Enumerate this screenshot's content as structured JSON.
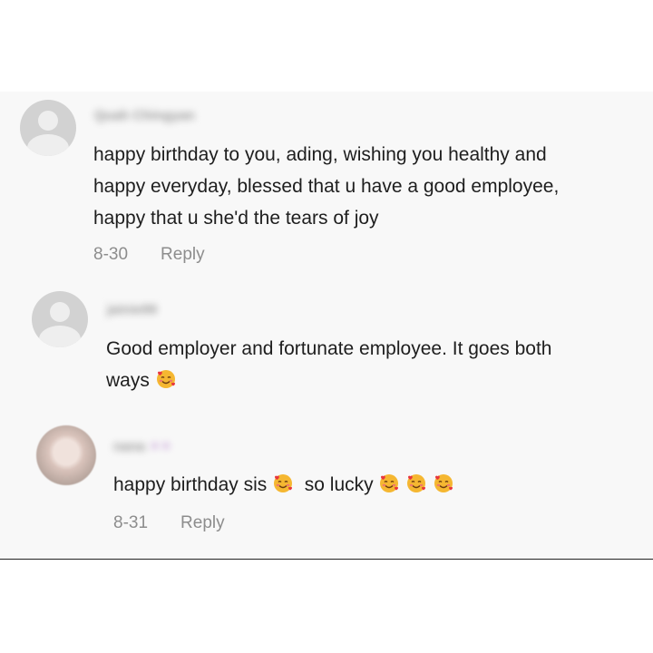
{
  "comments": [
    {
      "username": "Quah Chingyan",
      "lines": [
        "happy birthday to you, ading, wishing you healthy and",
        "happy everyday, blessed that u have a good employee,",
        "happy that u she'd the tears of joy"
      ],
      "date": "8-30",
      "reply_label": "Reply"
    },
    {
      "username": "jainie99",
      "lines": [
        "Good employer and fortunate employee. It goes both",
        "ways"
      ]
    },
    {
      "username": "nana",
      "text_a": "happy birthday sis",
      "text_b": "so lucky",
      "date": "8-31",
      "reply_label": "Reply"
    }
  ],
  "icons": {
    "emoji": "smiling-face-with-hearts-icon",
    "avatar": "default-avatar-icon"
  },
  "colors": {
    "panel": "#f8f8f8",
    "text": "#1e1e1e",
    "meta": "#8d8d8d"
  }
}
